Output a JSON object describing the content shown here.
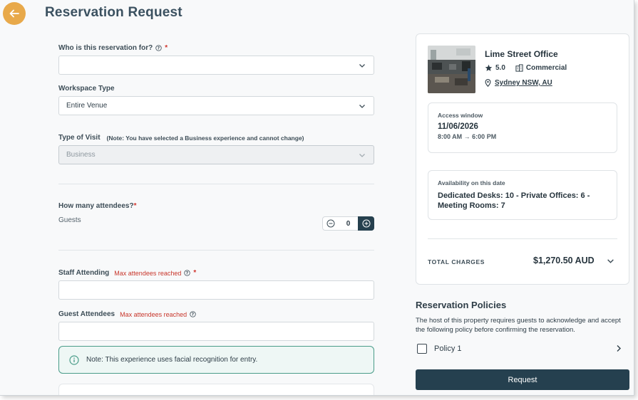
{
  "header": {
    "title": "Reservation Request"
  },
  "form": {
    "who_label": "Who is this reservation for?",
    "who_value": "",
    "workspace_label": "Workspace Type",
    "workspace_value": "Entire Venue",
    "visit_label": "Type of Visit",
    "visit_note": "(Note: You have selected a Business experience and cannot change)",
    "visit_value": "Business",
    "attendees_label": "How many attendees?",
    "guests_label": "Guests",
    "guests_value": "0",
    "staff_label": "Staff Attending",
    "staff_error": "Max attendees reached",
    "guest_attendees_label": "Guest Attendees",
    "guest_attendees_error": "Max attendees reached",
    "required_mark": "*",
    "info_note": "Note: This experience uses facial recognition for entry."
  },
  "summary": {
    "venue_name": "Lime Street Office",
    "rating": "5.0",
    "category": "Commercial",
    "location": "Sydney NSW, AU",
    "access_label": "Access window",
    "access_date": "11/06/2026",
    "access_time": "8:00 AM → 6:00 PM",
    "availability_label": "Availability on this date",
    "availability_text": "Dedicated Desks: 10 - Private Offices: 6 - Meeting Rooms: 7",
    "total_label": "TOTAL CHARGES",
    "total_amount": "$1,270.50 AUD"
  },
  "policies": {
    "title": "Reservation Policies",
    "description": "The host of this property requires guests to acknowledge and accept the following policy before confirming the reservation.",
    "items": [
      {
        "label": "Policy 1",
        "checked": false
      }
    ]
  },
  "actions": {
    "request_label": "Request"
  },
  "colors": {
    "accent": "#e8a94a",
    "primary": "#25404f",
    "error": "#c8362b",
    "info_border": "#4a9c89"
  }
}
